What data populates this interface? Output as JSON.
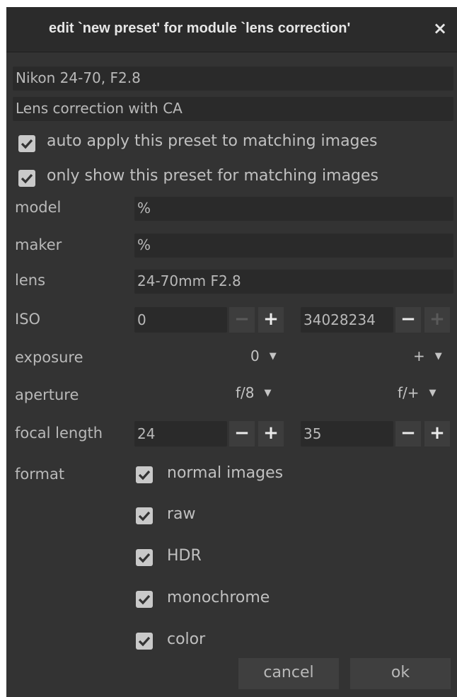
{
  "dialog": {
    "title": "edit `new preset' for module `lens correction'",
    "close_icon": "×"
  },
  "preset": {
    "name": "Nikon 24-70, F2.8",
    "description": "Lens correction with CA",
    "auto_apply": {
      "label": "auto apply this preset to matching images",
      "checked": true
    },
    "only_show": {
      "label": "only show this preset for matching images",
      "checked": true
    }
  },
  "filters": {
    "model": {
      "label": "model",
      "value": "%"
    },
    "maker": {
      "label": "maker",
      "value": "%"
    },
    "lens": {
      "label": "lens",
      "value": "24-70mm F2.8"
    },
    "iso": {
      "label": "ISO",
      "min": "0",
      "max": "34028234"
    },
    "exposure": {
      "label": "exposure",
      "min": "0",
      "max": "+"
    },
    "aperture": {
      "label": "aperture",
      "min": "f/8",
      "max": "f/+"
    },
    "focal_length": {
      "label": "focal length",
      "min": "24",
      "max": "35"
    },
    "format": {
      "label": "format",
      "options": [
        {
          "label": "normal images",
          "checked": true
        },
        {
          "label": "raw",
          "checked": true
        },
        {
          "label": "HDR",
          "checked": true
        },
        {
          "label": "monochrome",
          "checked": true
        },
        {
          "label": "color",
          "checked": true
        }
      ]
    }
  },
  "stepper": {
    "minus": "−",
    "plus": "+"
  },
  "dropdown_arrow": "▼",
  "buttons": {
    "cancel": "cancel",
    "ok": "ok"
  },
  "colors": {
    "background": "#333333",
    "field": "#2a2a2a",
    "text": "#b9b9b9",
    "checkbox": "#c9c9c9"
  }
}
